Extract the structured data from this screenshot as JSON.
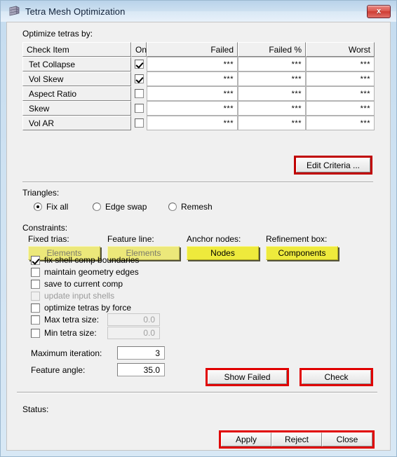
{
  "window": {
    "title": "Tetra Mesh Optimization",
    "icon": "mesh-cube-icon",
    "close_label": "x"
  },
  "sections": {
    "optimize_label": "Optimize tetras by:",
    "triangles_label": "Triangles:",
    "constraints_label": "Constraints:",
    "status_label": "Status:"
  },
  "table": {
    "headers": [
      "Check Item",
      "On",
      "Failed",
      "Failed %",
      "Worst"
    ],
    "rows": [
      {
        "name": "Tet Collapse",
        "on": true,
        "failed": "***",
        "failed_pct": "***",
        "worst": "***"
      },
      {
        "name": "Vol Skew",
        "on": true,
        "failed": "***",
        "failed_pct": "***",
        "worst": "***"
      },
      {
        "name": "Aspect Ratio",
        "on": false,
        "failed": "***",
        "failed_pct": "***",
        "worst": "***"
      },
      {
        "name": "Skew",
        "on": false,
        "failed": "***",
        "failed_pct": "***",
        "worst": "***"
      },
      {
        "name": "Vol AR",
        "on": false,
        "failed": "***",
        "failed_pct": "***",
        "worst": "***"
      }
    ]
  },
  "buttons": {
    "edit_criteria": "Edit Criteria ...",
    "show_failed": "Show Failed",
    "check": "Check",
    "apply": "Apply",
    "reject": "Reject",
    "close": "Close"
  },
  "triangles": {
    "options": [
      {
        "label": "Fix all",
        "selected": true
      },
      {
        "label": "Edge swap",
        "selected": false
      },
      {
        "label": "Remesh",
        "selected": false
      }
    ]
  },
  "constraints": [
    {
      "label": "Fixed trias:",
      "button": "Elements",
      "enabled": false
    },
    {
      "label": "Feature line:",
      "button": "Elements",
      "enabled": false
    },
    {
      "label": "Anchor nodes:",
      "button": "Nodes",
      "enabled": true
    },
    {
      "label": "Refinement box:",
      "button": "Components",
      "enabled": true
    }
  ],
  "options": [
    {
      "label": "fix shell comp boundaries",
      "checked": true,
      "enabled": true
    },
    {
      "label": "maintain geometry edges",
      "checked": false,
      "enabled": true
    },
    {
      "label": "save to current comp",
      "checked": false,
      "enabled": true
    },
    {
      "label": "update input shells",
      "checked": false,
      "enabled": false
    },
    {
      "label": "optimize tetras by force",
      "checked": false,
      "enabled": true
    }
  ],
  "size_limits": [
    {
      "label": "Max tetra size:",
      "checked": false,
      "value": "0.0",
      "enabled": false
    },
    {
      "label": "Min tetra size:",
      "checked": false,
      "value": "0.0",
      "enabled": false
    }
  ],
  "numeric_fields": [
    {
      "label": "Maximum iteration:",
      "value": "3"
    },
    {
      "label": "Feature angle:",
      "value": "35.0"
    }
  ],
  "colors": {
    "accent_red": "#c00000",
    "bright_red": "#e00000",
    "yellow_button": "#eeea3c",
    "yellow_button_disabled": "#ece87a",
    "dialog_bg": "#f0f0f0"
  }
}
